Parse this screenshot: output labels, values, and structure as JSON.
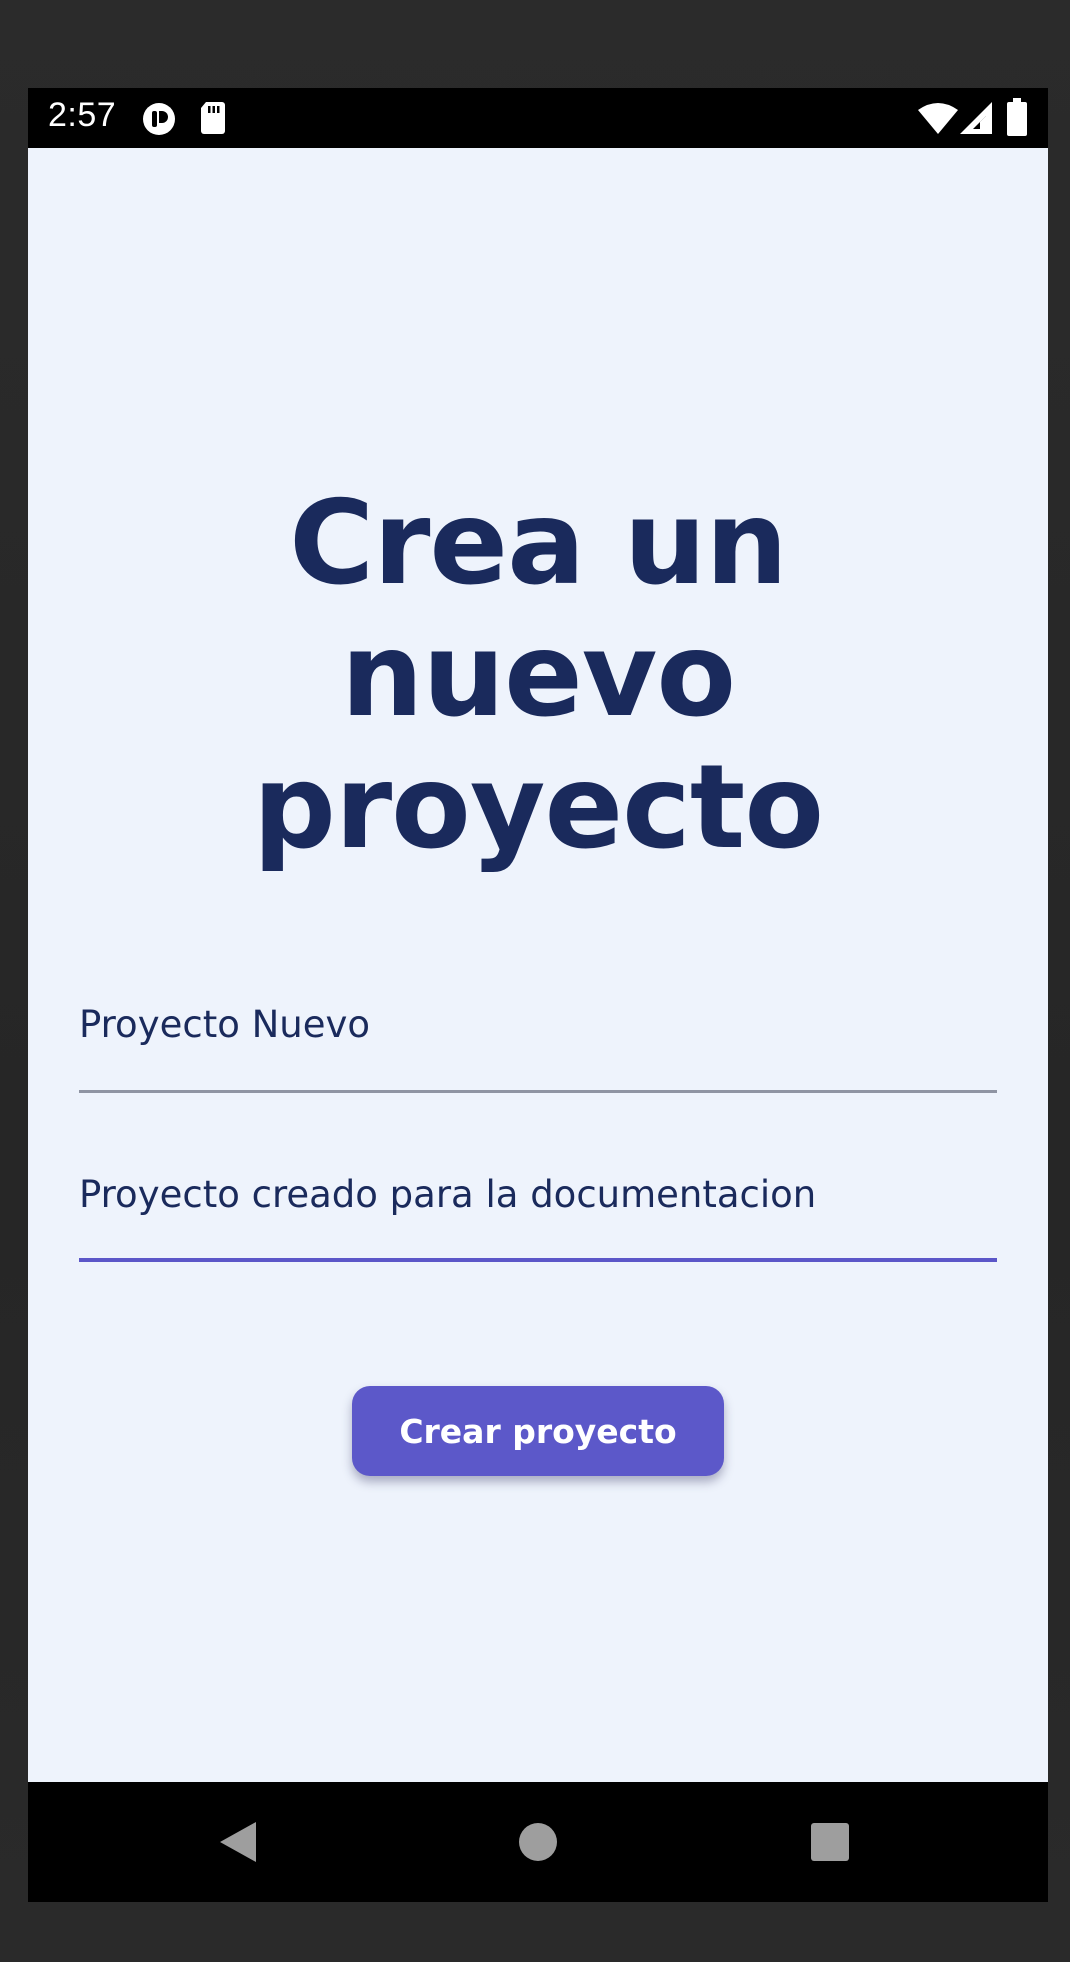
{
  "status_bar": {
    "time": "2:57",
    "left_icons": [
      "app-notification-icon",
      "sd-card-icon"
    ],
    "right_icons": [
      "wifi-icon",
      "cell-signal-icon",
      "battery-icon"
    ]
  },
  "screen": {
    "title": "Crea un nuevo proyecto",
    "fields": {
      "name_value": "Proyecto Nuevo",
      "description_value": "Proyecto creado para la documentacion"
    },
    "create_button_label": "Crear proyecto"
  },
  "nav_bar": {
    "icons": [
      "back-icon",
      "home-icon",
      "recents-icon"
    ]
  },
  "colors": {
    "background": "#eef3fc",
    "title_text": "#1a2a5c",
    "accent": "#5c58c9",
    "inactive_underline": "#8f94a3"
  }
}
